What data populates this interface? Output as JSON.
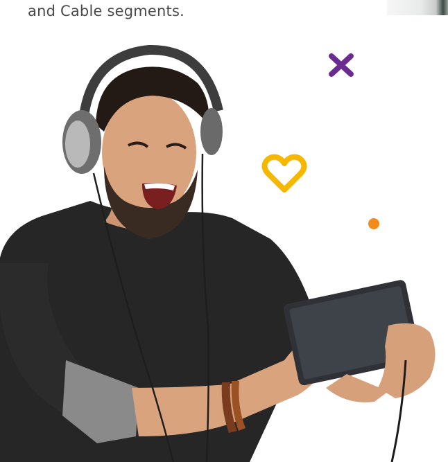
{
  "caption": {
    "text": "and Cable segments."
  },
  "photo": {
    "subject": "man-with-headphones-and-tablet"
  },
  "decorations": {
    "cross_color": "#6b2a8f",
    "heart_color": "#f5b700",
    "dot_color": "#f28a1c"
  }
}
